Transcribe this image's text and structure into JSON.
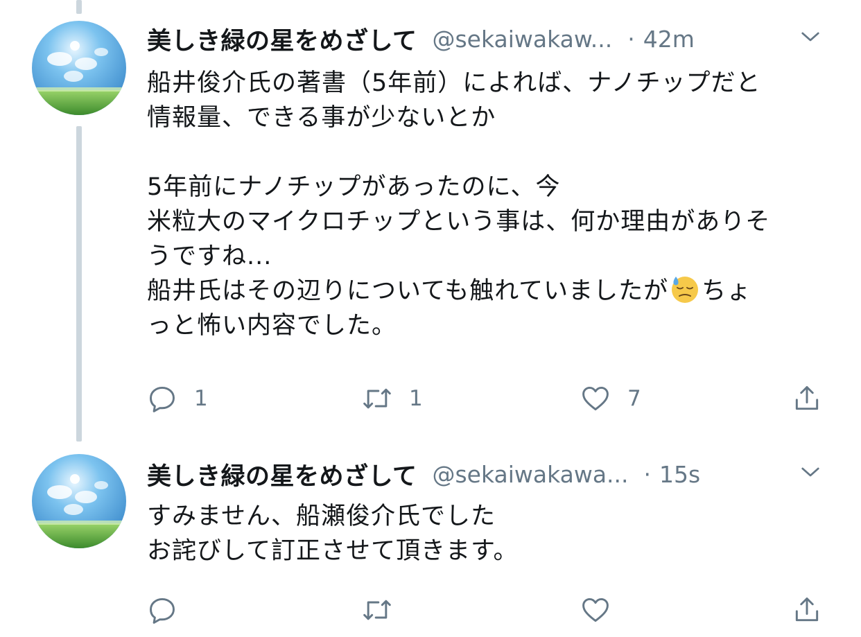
{
  "tweets": [
    {
      "display_name": "美しき緑の星をめざして",
      "handle": "@sekaiwakaw...",
      "separator": "·",
      "time": "42m",
      "text_before_emoji": "船井俊介氏の著書（5年前）によれば、ナノチップだと\n情報量、できる事が少ないとか\n\n5年前にナノチップがあったのに、今\n米粒大のマイクロチップという事は、何か理由がありそ\nうですね...\n船井氏はその辺りについても触れていましたが",
      "emoji": "downcast-face-with-sweat",
      "text_after_emoji": "ちょ\nっと怖い内容でした。",
      "reply_count": "1",
      "retweet_count": "1",
      "like_count": "7"
    },
    {
      "display_name": "美しき緑の星をめざして",
      "handle": "@sekaiwakawa...",
      "separator": "·",
      "time": "15s",
      "text": "すみません、船瀬俊介氏でした\nお詫びして訂正させて頂きます。",
      "reply_count": "",
      "retweet_count": "",
      "like_count": ""
    }
  ],
  "colors": {
    "text": "#14171a",
    "secondary": "#657786",
    "thread_line": "#ccd6dd",
    "background": "#ffffff"
  }
}
